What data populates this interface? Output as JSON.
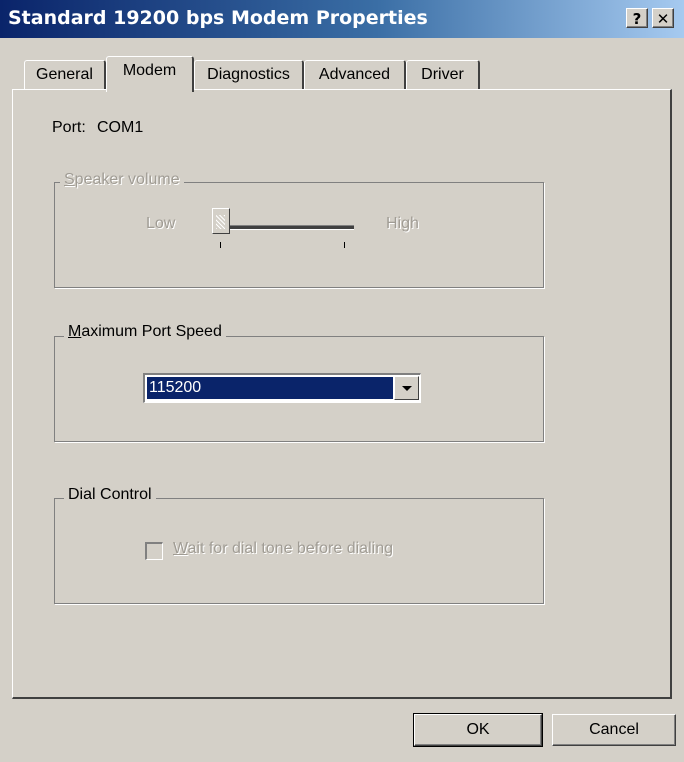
{
  "window": {
    "title": "Standard 19200 bps Modem Properties",
    "help_glyph": "?",
    "close_glyph": "✕"
  },
  "tabs": [
    {
      "label": "General",
      "active": false
    },
    {
      "label": "Modem",
      "active": true
    },
    {
      "label": "Diagnostics",
      "active": false
    },
    {
      "label": "Advanced",
      "active": false
    },
    {
      "label": "Driver",
      "active": false
    }
  ],
  "port": {
    "label": "Port:",
    "value": "COM1"
  },
  "speaker_volume": {
    "legend_first": "S",
    "legend_rest": "peaker volume",
    "low_label": "Low",
    "high_label": "High",
    "level": 0,
    "enabled": false
  },
  "max_port_speed": {
    "legend_first": "M",
    "legend_rest": "aximum Port Speed",
    "selected": "115200"
  },
  "dial_control": {
    "legend": "Dial Control",
    "checkbox_first": "W",
    "checkbox_rest": "ait for dial tone before dialing",
    "checked": false,
    "enabled": false
  },
  "buttons": {
    "ok": "OK",
    "cancel": "Cancel"
  },
  "colors": {
    "face": "#d4d0c8",
    "title_active": "#0a246a",
    "selection": "#0a246a",
    "disabled_text": "#a09c94"
  }
}
